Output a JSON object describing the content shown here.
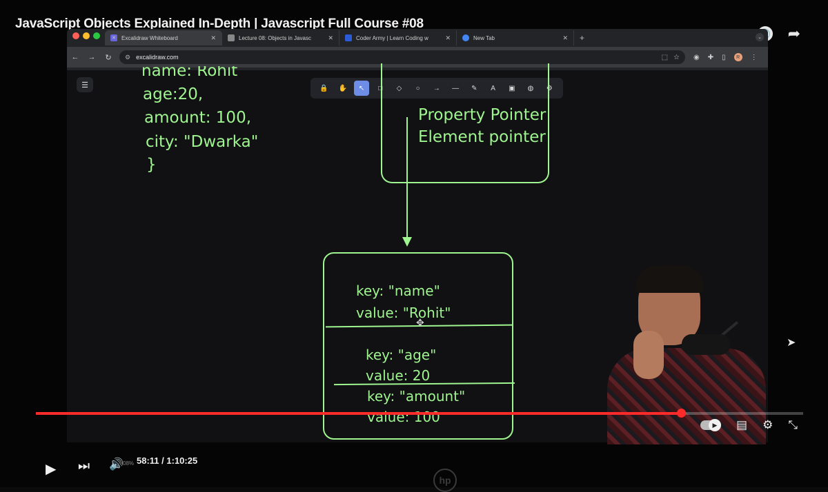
{
  "video": {
    "title": "JavaScript Objects Explained In-Depth | Javascript Full Course #08",
    "time_display": "58:11 / 1:10:25",
    "volume_pct": "08%",
    "progress_fraction": 0.841
  },
  "browser": {
    "tabs": [
      {
        "label": "Excalidraw Whiteboard",
        "active": true,
        "favicon_color": "#6965db"
      },
      {
        "label": "Lecture 08: Objects in Javasc",
        "active": false,
        "favicon_color": "#888888"
      },
      {
        "label": "Coder Army | Learn Coding w",
        "active": false,
        "favicon_color": "#2b5bd6"
      },
      {
        "label": "New Tab",
        "active": false,
        "favicon_color": "#4285f4"
      }
    ],
    "tab_close": "✕",
    "new_tab": "+",
    "url": "excalidraw.com",
    "profile_initial": "R"
  },
  "excalidraw": {
    "tools": [
      "🔒",
      "✋",
      "↖",
      "□",
      "◇",
      "○",
      "→",
      "—",
      "✎",
      "A",
      "▣",
      "◍",
      "⚙"
    ],
    "selected_tool_index": 2
  },
  "whiteboard": {
    "object_lines": [
      "name: Rohit",
      "age:20,",
      "amount: 100,",
      "city: \"Dwarka\"",
      "}"
    ],
    "shape_lines": [
      "Property Pointer",
      "Element pointer"
    ],
    "entries": [
      {
        "key": "key: \"name\"",
        "value": "value: \"Rohit\""
      },
      {
        "key": "key: \"age\"",
        "value": "value: 20"
      },
      {
        "key": "key: \"amount\"",
        "value": "value: 100"
      }
    ]
  },
  "colors": {
    "chalk_green": "#9ff58f",
    "progress_red": "#ff2a2a",
    "tool_selected": "#6e8de6"
  },
  "brand": "hp"
}
